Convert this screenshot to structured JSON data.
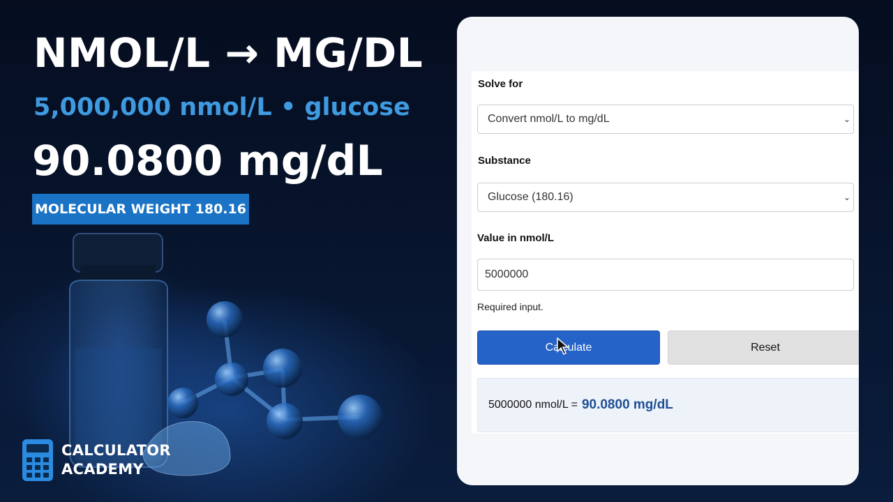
{
  "hero": {
    "title": "NMOL/L → MG/DL",
    "subtitle": "5,000,000 nmol/L • glucose",
    "result": "90.0800 mg/dL",
    "badge": "MOLECULAR WEIGHT 180.16"
  },
  "brand": {
    "line1": "CALCULATOR",
    "line2": "ACADEMY",
    "icon": "calculator-icon"
  },
  "form": {
    "solve_for_label": "Solve for",
    "solve_for_value": "Convert nmol/L to mg/dL",
    "substance_label": "Substance",
    "substance_value": "Glucose (180.16)",
    "value_label": "Value in nmol/L",
    "value_input": "5000000",
    "hint": "Required input.",
    "calculate_label": "Calculate",
    "reset_label": "Reset",
    "result_prefix": "5000000 nmol/L =",
    "result_value": "90.0800 mg/dL"
  },
  "icons": {
    "select_arrow": "chevron-down-icon",
    "pointer": "cursor-icon"
  },
  "colors": {
    "accent": "#2563c9",
    "subtitle": "#3f9ae0",
    "badge": "#1a73c4",
    "result_value": "#1f4f94"
  }
}
